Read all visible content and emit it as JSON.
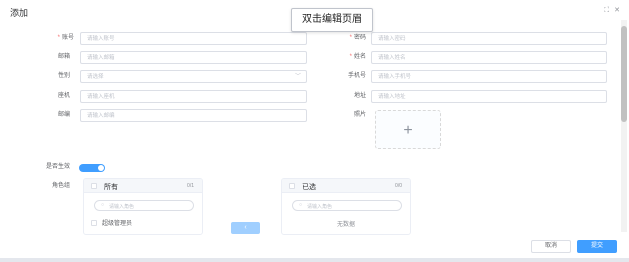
{
  "dialog": {
    "title": "添加",
    "fullscreen_icon": "⛶",
    "close_icon": "✕"
  },
  "tooltip": {
    "text": "双击编辑页眉"
  },
  "form": {
    "account": {
      "label": "账号",
      "placeholder": "请输入账号"
    },
    "password": {
      "label": "密码",
      "placeholder": "请输入密码"
    },
    "email": {
      "label": "邮箱",
      "placeholder": "请输入邮箱"
    },
    "name": {
      "label": "姓名",
      "placeholder": "请输入姓名"
    },
    "gender": {
      "label": "性别",
      "placeholder": "请选择"
    },
    "phone": {
      "label": "手机号",
      "placeholder": "请输入手机号"
    },
    "landline": {
      "label": "座机",
      "placeholder": "请输入座机"
    },
    "address": {
      "label": "地址",
      "placeholder": "请输入地址"
    },
    "postcode": {
      "label": "邮编",
      "placeholder": "请输入邮编"
    },
    "photo": {
      "label": "照片",
      "plus": "+"
    },
    "enabled": {
      "label": "是否生效",
      "value": true
    },
    "roles": {
      "label": "角色组"
    }
  },
  "transfer": {
    "left": {
      "title": "所有",
      "count": "0/1",
      "search_placeholder": "请输入角色",
      "search_icon": "🔍",
      "items": [
        "超级管理员"
      ]
    },
    "right": {
      "title": "已选",
      "count": "0/0",
      "search_placeholder": "请输入角色",
      "search_icon": "🔍",
      "empty_text": "无数据"
    },
    "move_left": "‹"
  },
  "footer": {
    "cancel": "取消",
    "submit": "提交"
  },
  "colors": {
    "primary": "#409eff",
    "required": "#f56c6c",
    "border": "#dcdfe6"
  }
}
